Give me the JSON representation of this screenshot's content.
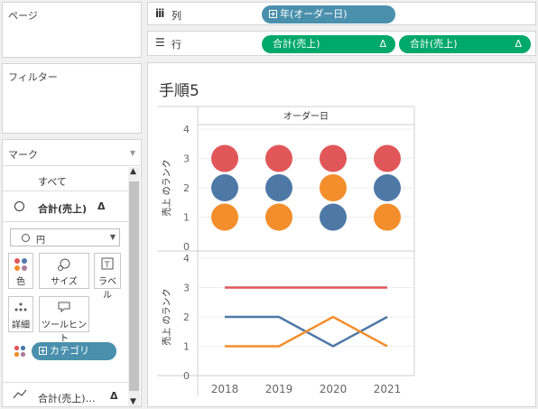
{
  "panels": {
    "pages": "ページ",
    "filters": "フィルター",
    "marks": "マーク"
  },
  "marks": {
    "all_label": "すべて",
    "measure1": "合計(売上)",
    "delta": "Δ",
    "mark_type": "円",
    "buttons": [
      "色",
      "サイズ",
      "ラベル",
      "詳細",
      "ツールヒント"
    ],
    "color_pill": "カテゴリ",
    "measure2": "合計(売上)…"
  },
  "shelves": {
    "columns_label": "列",
    "columns_pill": "年(オーダー日)",
    "rows_label": "行",
    "rows_pills": [
      "合計(売上)",
      "合計(売上)"
    ]
  },
  "sheet": {
    "title": "手順5",
    "header": "オーダー日",
    "ylabel": "売上 のランク",
    "x_ticks": [
      "2018",
      "2019",
      "2020",
      "2021"
    ],
    "y_ticks": [
      "4",
      "3",
      "2",
      "1",
      "0"
    ]
  },
  "colors": {
    "red": "#e15759",
    "blue": "#4e79a7",
    "orange": "#f28e2b",
    "green": "#00a86b",
    "teal": "#4a90ad"
  },
  "chart_data": [
    {
      "type": "scatter",
      "x": [
        "2018",
        "2019",
        "2020",
        "2021"
      ],
      "ylabel": "売上 のランク",
      "ylim": [
        0,
        4
      ],
      "series": [
        {
          "color": "red",
          "values": [
            3,
            3,
            3,
            3
          ]
        },
        {
          "color": "blue",
          "values": [
            2,
            2,
            1,
            2
          ]
        },
        {
          "color": "orange",
          "values": [
            1,
            1,
            2,
            1
          ]
        }
      ]
    },
    {
      "type": "line",
      "x": [
        "2018",
        "2019",
        "2020",
        "2021"
      ],
      "ylabel": "売上 のランク",
      "ylim": [
        0,
        4
      ],
      "series": [
        {
          "color": "red",
          "values": [
            3,
            3,
            3,
            3
          ]
        },
        {
          "color": "blue",
          "values": [
            2,
            2,
            1,
            2
          ]
        },
        {
          "color": "orange",
          "values": [
            1,
            1,
            2,
            1
          ]
        }
      ]
    }
  ]
}
